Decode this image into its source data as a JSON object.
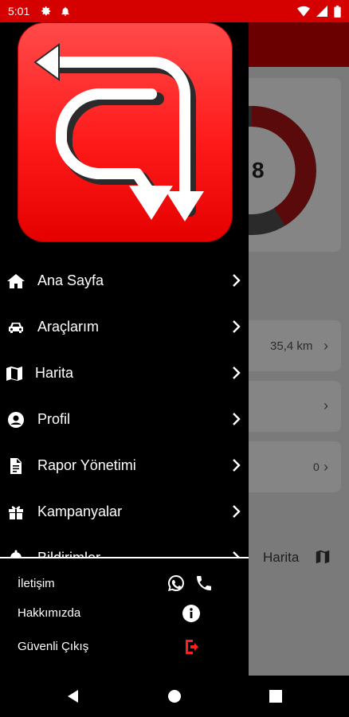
{
  "status_bar": {
    "time": "5:01",
    "icons": [
      "settings-icon",
      "notification-bell-icon",
      "wifi-icon",
      "signal-icon",
      "battery-icon"
    ]
  },
  "logo": {
    "icon": "app-logo-arrows"
  },
  "drawer": {
    "menu_items": [
      {
        "label": "Ana Sayfa",
        "icon": "home-icon"
      },
      {
        "label": "Araçlarım",
        "icon": "car-icon"
      },
      {
        "label": "Harita",
        "icon": "map-icon"
      },
      {
        "label": "Profil",
        "icon": "user-circle-icon"
      },
      {
        "label": "Rapor Yönetimi",
        "icon": "document-icon"
      },
      {
        "label": "Kampanyalar",
        "icon": "gift-icon"
      },
      {
        "label": "Bildirimler",
        "icon": "bell-icon"
      }
    ],
    "footer": {
      "contact": {
        "label": "İletişim",
        "icons": [
          "whatsapp-icon",
          "phone-icon"
        ]
      },
      "about": {
        "label": "Hakkımızda",
        "icon": "info-icon"
      },
      "logout": {
        "label": "Güvenli Çıkış",
        "icon": "logout-icon"
      }
    }
  },
  "background": {
    "donut_value": "8",
    "distance": "35,4 km",
    "count": "0",
    "map_label": "Harita"
  },
  "colors": {
    "accent": "#d50000",
    "logout": "#ff1f1f",
    "drawer_bg": "#000000"
  }
}
